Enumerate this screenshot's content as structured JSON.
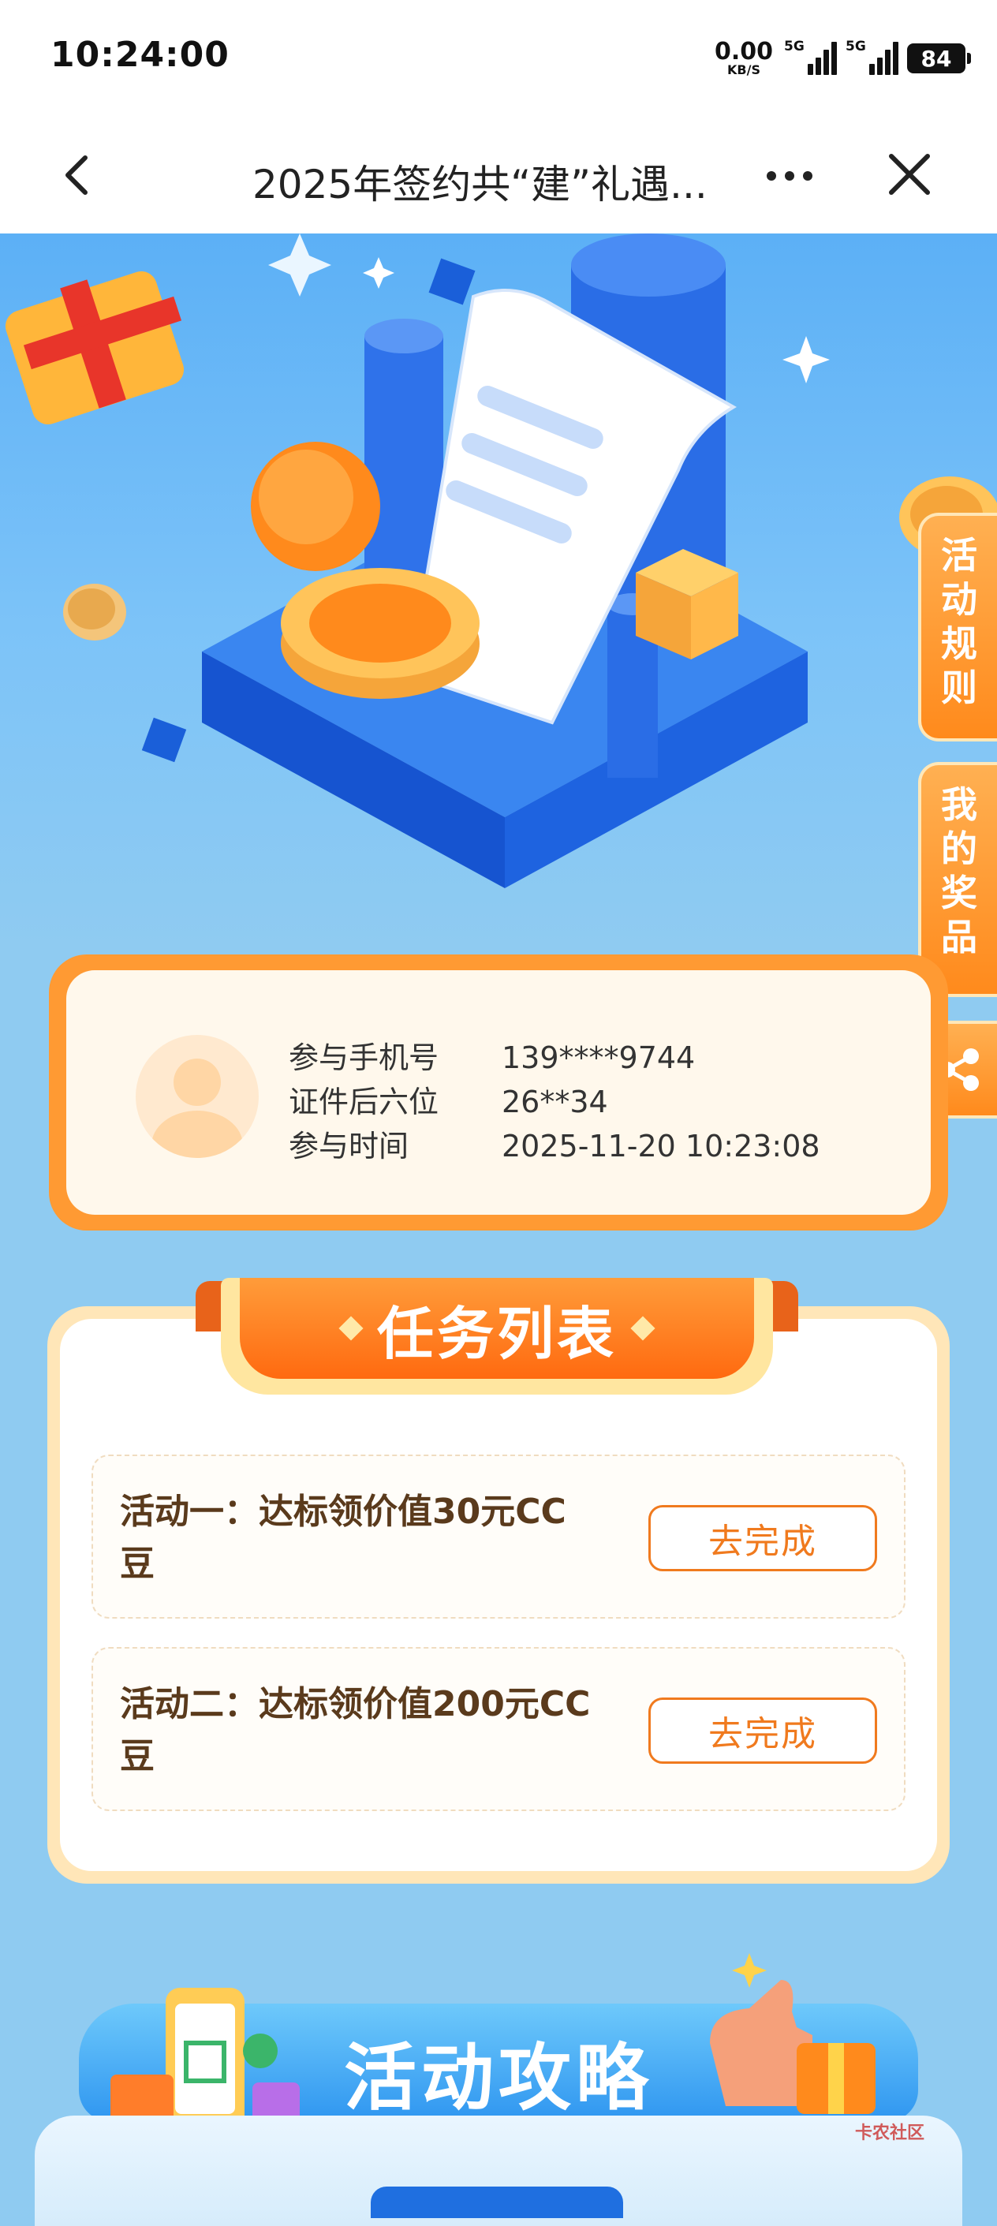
{
  "status_bar": {
    "time": "10:24:00",
    "net_speed": "0.00",
    "net_unit": "KB/S",
    "sim1": "5G",
    "sim2": "5G",
    "battery": "84"
  },
  "nav": {
    "title": "2025年签约共“建”礼遇..."
  },
  "side_tabs": {
    "rules": [
      "活",
      "动",
      "规",
      "则"
    ],
    "prizes": [
      "我",
      "的",
      "奖",
      "品"
    ]
  },
  "user_info": {
    "phone_label": "参与手机号",
    "phone_value": "139****9744",
    "id_label": "证件后六位",
    "id_value": "26**34",
    "time_label": "参与时间",
    "time_value": "2025-11-20 10:23:08"
  },
  "tasks": {
    "title": "任务列表",
    "items": [
      {
        "text": "活动一：达标领价值30元CC豆",
        "button": "去完成"
      },
      {
        "text": "活动二：达标领价值200元CC豆",
        "button": "去完成"
      }
    ]
  },
  "guide": {
    "title": "活动攻略"
  },
  "watermark": "卡农社区",
  "colors": {
    "accent_orange": "#ff8a1c",
    "button_orange": "#f07a1e",
    "task_text": "#5a3a1c",
    "hero_blue": "#5cb0f6",
    "page_blue": "#8fcbf1"
  }
}
